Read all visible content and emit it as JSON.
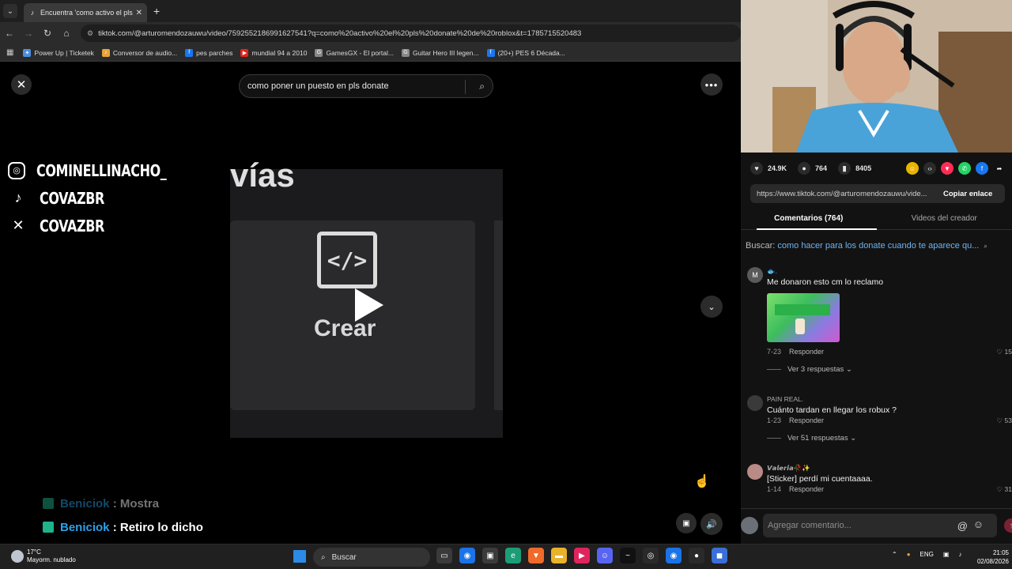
{
  "browser": {
    "tab_title": "Encuentra 'como activo el pls d",
    "tab_close": "✕",
    "newtab": "+",
    "url": "tiktok.com/@arturomendozauwu/video/7592552186991627541?q=como%20activo%20el%20pls%20donate%20de%20roblox&t=1785715520483",
    "bookmarks": [
      {
        "label": "Power Up | Ticketek",
        "color": "#4a90e2",
        "glyph": "✦"
      },
      {
        "label": "Conversor de audio...",
        "color": "#e8a33a",
        "glyph": "♪"
      },
      {
        "label": "pes parches",
        "color": "#1877f2",
        "glyph": "f"
      },
      {
        "label": "mundial 94 a 2010",
        "color": "#e62117",
        "glyph": "▶"
      },
      {
        "label": "GamesGX - El portal...",
        "color": "#888888",
        "glyph": "G"
      },
      {
        "label": "Guitar Hero III legen...",
        "color": "#888888",
        "glyph": "G"
      },
      {
        "label": "(20+) PES 6 Década...",
        "color": "#1877f2",
        "glyph": "f"
      }
    ]
  },
  "tiktok": {
    "search_text": "como poner un puesto en pls donate",
    "video_headline": "vías",
    "crear_icon": "</>",
    "crear_label": "Crear"
  },
  "overlay": {
    "socials": [
      {
        "icon": "instagram-icon",
        "glyph": "◎",
        "name": "COMINELLINACHO_"
      },
      {
        "icon": "tiktok-icon",
        "glyph": "♪",
        "name": "COVAZBR"
      },
      {
        "icon": "x-icon",
        "glyph": "✕",
        "name": "COVAZBR"
      }
    ],
    "chat": [
      {
        "user": "Beniciok",
        "sep": " : ",
        "message": "Mostra",
        "faded": true
      },
      {
        "user": "Beniciok",
        "sep": " : ",
        "message": "Retiro lo dicho",
        "faded": false
      }
    ]
  },
  "panel": {
    "likes": "24.9K",
    "comments_count": "764",
    "saves": "8405",
    "link": "https://www.tiktok.com/@arturomendozauwu/vide...",
    "copy_label": "Copiar enlace",
    "tab_comments": "Comentarios (764)",
    "tab_creator": "Videos del creador",
    "search_prefix": "Buscar: ",
    "search_query": "como hacer para los donate cuando te aparece qu...",
    "comments": [
      {
        "avatar": "M",
        "user": "🐟.",
        "text": "Me donaron esto cm lo reclamo",
        "date": "7-23",
        "reply": "Responder",
        "likes": "15",
        "replies": "Ver 3 respuestas ⌄"
      },
      {
        "avatar": "",
        "user": "PAIN REAL.",
        "text": "Cuánto tardan en llegar los robux ?",
        "date": "1-23",
        "reply": "Responder",
        "likes": "53",
        "replies": "Ver 51 respuestas ⌄"
      },
      {
        "avatar": "",
        "user": "𝙑𝙖𝙡𝙚𝙧𝙞𝙖🥀✨",
        "text": "[Sticker] perdí mi cuentaaaa.",
        "date": "1-14",
        "reply": "Responder",
        "likes": "31",
        "replies": ""
      }
    ],
    "composer_placeholder": "Agregar comentario...",
    "at": "@",
    "emoji": "☺"
  },
  "taskbar": {
    "temp": "17°C",
    "weather": "Mayorm. nublado",
    "search": "Buscar",
    "lang": "ENG",
    "time": "21:05",
    "date": "02/08/2026"
  }
}
